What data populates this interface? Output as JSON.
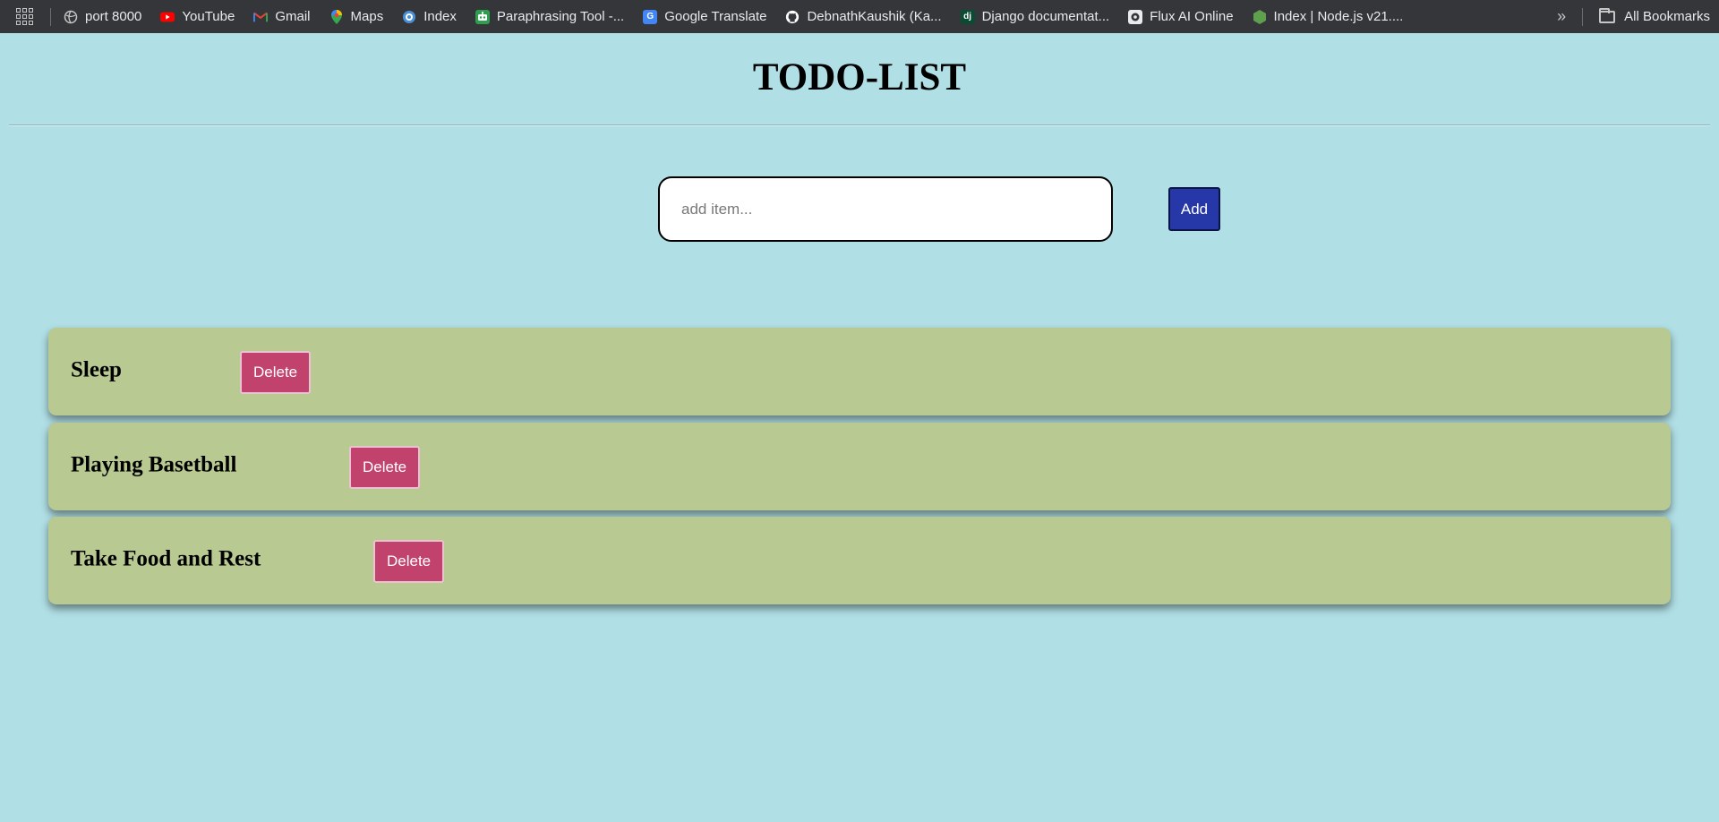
{
  "bookmarks": [
    {
      "label": "port 8000",
      "icon": "globe-icon",
      "color": "#9aa0a6"
    },
    {
      "label": "YouTube",
      "icon": "youtube-icon",
      "color": "#ff0000"
    },
    {
      "label": "Gmail",
      "icon": "gmail-icon",
      "color": "#ea4335"
    },
    {
      "label": "Maps",
      "icon": "maps-icon",
      "color": "#34a853"
    },
    {
      "label": "Index",
      "icon": "index-icon",
      "color": "#4a90d9"
    },
    {
      "label": "Paraphrasing Tool -...",
      "icon": "paraphrasing-icon",
      "color": "#2e9e4f"
    },
    {
      "label": "Google Translate",
      "icon": "translate-icon",
      "color": "#4285f4"
    },
    {
      "label": "DebnathKaushik (Ka...",
      "icon": "github-icon",
      "color": "#ffffff"
    },
    {
      "label": "Django documentat...",
      "icon": "django-icon",
      "color": "#0c4b33"
    },
    {
      "label": "Flux AI Online",
      "icon": "flux-icon",
      "color": "#e8eaed"
    },
    {
      "label": "Index | Node.js v21....",
      "icon": "nodejs-icon",
      "color": "#5fa04e"
    }
  ],
  "all_bookmarks_label": "All Bookmarks",
  "page": {
    "title": "TODO-LIST",
    "input_placeholder": "add item...",
    "input_value": "",
    "add_label": "Add"
  },
  "items": [
    {
      "text": "Sleep",
      "delete_label": "Delete"
    },
    {
      "text": "Playing Basetball",
      "delete_label": "Delete"
    },
    {
      "text": "Take Food and Rest",
      "delete_label": "Delete"
    }
  ],
  "colors": {
    "background": "#b0dfe5",
    "item_background": "#b8c991",
    "add_button": "#2638a8",
    "delete_button": "#c2426e"
  }
}
